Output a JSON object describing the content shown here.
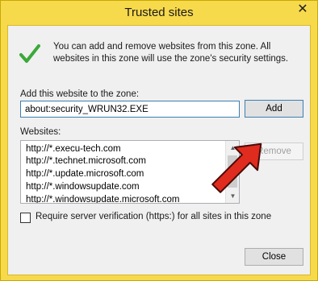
{
  "window": {
    "title": "Trusted sites",
    "close_glyph": "✕"
  },
  "info": {
    "icon": "green-checkmark-icon",
    "text": "You can add and remove websites from this zone. All websites in this zone will use the zone's security settings."
  },
  "add_section": {
    "label": "Add this website to the zone:",
    "input_value": "about:security_WRUN32.EXE",
    "add_label": "Add"
  },
  "websites": {
    "label": "Websites:",
    "items": [
      "http://*.execu-tech.com",
      "http://*.technet.microsoft.com",
      "http://*.update.microsoft.com",
      "http://*.windowsupdate.com",
      "http://*.windowsupdate.microsoft.com"
    ],
    "remove_label": "Remove"
  },
  "require_verification": {
    "label": "Require server verification (https:) for all sites in this zone",
    "checked": false
  },
  "footer": {
    "close_label": "Close"
  },
  "colors": {
    "title_bar": "#f7d94c",
    "checkmark": "#3aa93a",
    "arrow": "#e02b1f"
  }
}
